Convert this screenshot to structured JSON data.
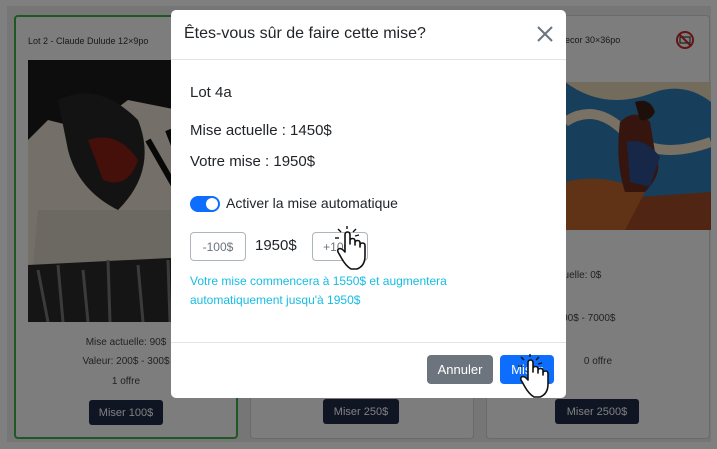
{
  "lots": {
    "left": {
      "title": "Lot 2 - Claude Dulude 12×9po",
      "current_bid": "Mise actuelle: 90$",
      "value": "Valeur: 200$ - 300$",
      "offers": "1 offre",
      "bid_button": "Miser 100$"
    },
    "mid": {
      "bid_button": "Miser 250$"
    },
    "right": {
      "title": "ecor 30×36po",
      "current_bid": "ise actuelle: 0$",
      "value": "ur: 4500$ - 7000$",
      "offers": "0 offre",
      "bid_button": "Miser 2500$",
      "no_bid_icon": "no-bid-icon"
    }
  },
  "modal": {
    "title": "Êtes-vous sûr de faire cette mise?",
    "lot": "Lot 4a",
    "current_bid": "Mise actuelle : 1450$",
    "your_bid": "Votre mise : 1950$",
    "auto_bid_label": "Activer la mise automatique",
    "auto_bid_enabled": true,
    "decrement_label": "-100$",
    "increment_label": "+100$",
    "bid_amount": "1950$",
    "hint": "Votre mise commencera à 1550$ et augmentera automatiquement jusqu'à 1950$",
    "cancel_label": "Annuler",
    "confirm_label": "Miser"
  },
  "colors": {
    "primary": "#0d6efd",
    "secondary": "#6c757d",
    "hint": "#15bde3",
    "dark_button": "#1e2a45",
    "selected_border": "#3fae4a"
  },
  "icons": [
    "close-icon",
    "no-bid-icon",
    "hand-pointer-icon"
  ]
}
